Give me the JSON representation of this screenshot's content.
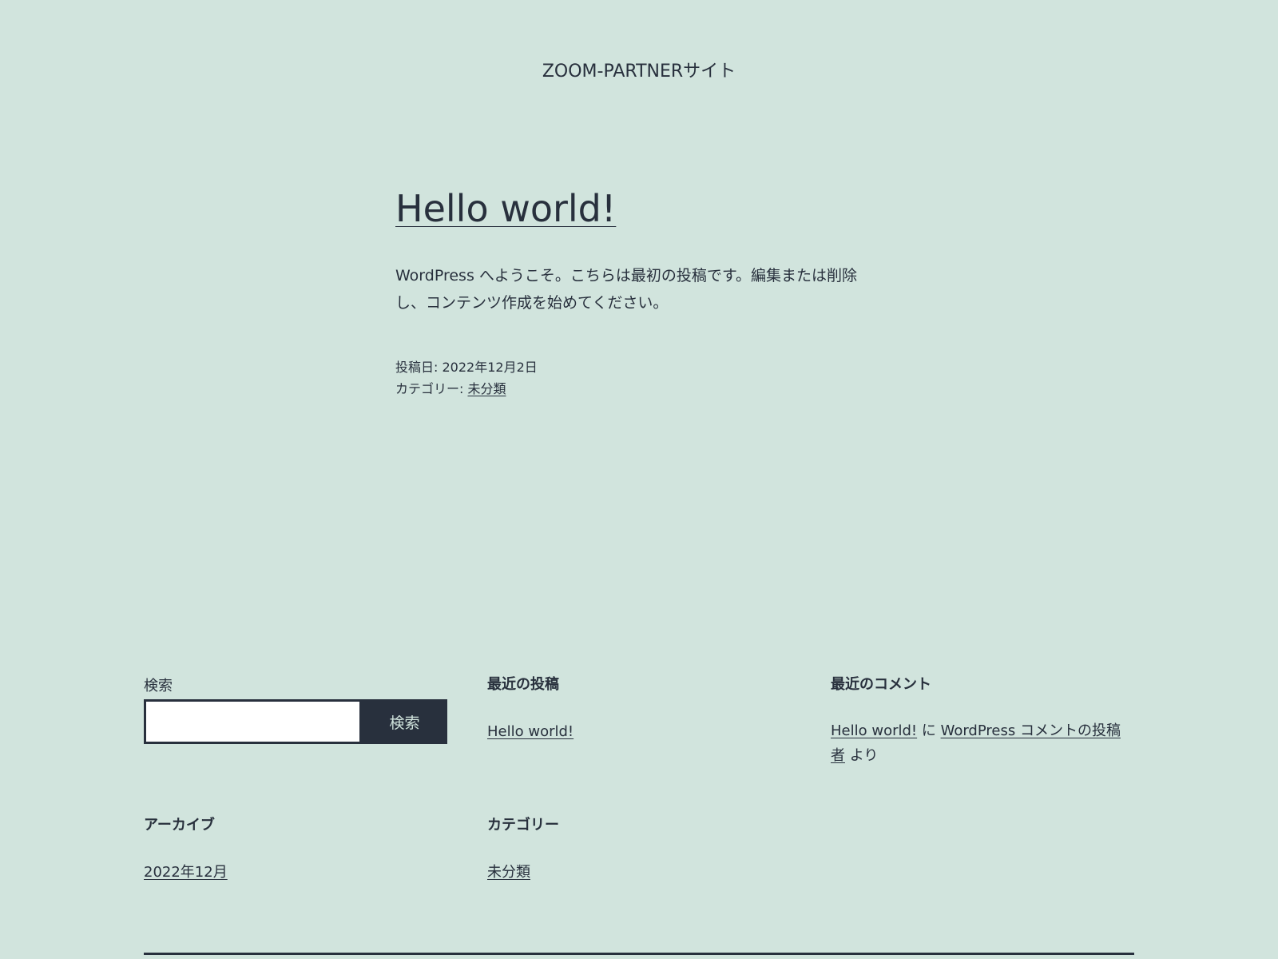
{
  "header": {
    "site_title": "ZOOM-PARTNERサイト"
  },
  "post": {
    "title": "Hello world!",
    "body": "WordPress へようこそ。こちらは最初の投稿です。編集または削除し、コンテンツ作成を始めてください。",
    "meta": {
      "date_label": "投稿日: ",
      "date": "2022年12月2日",
      "category_label": "カテゴリー: ",
      "category": "未分類"
    }
  },
  "footer": {
    "search": {
      "label": "検索",
      "button_label": "検索",
      "value": "",
      "placeholder": ""
    },
    "recent_posts": {
      "heading": "最近の投稿",
      "items": [
        "Hello world!"
      ]
    },
    "recent_comments": {
      "heading": "最近のコメント",
      "post_link": "Hello world!",
      "connector": " に ",
      "author_link": "WordPress コメントの投稿者",
      "suffix": " より"
    },
    "archives": {
      "heading": "アーカイブ",
      "items": [
        "2022年12月"
      ]
    },
    "categories": {
      "heading": "カテゴリー",
      "items": [
        "未分類"
      ]
    }
  },
  "colors": {
    "background": "#d1e4dd",
    "text": "#28303d",
    "input_background": "#ffffff"
  }
}
